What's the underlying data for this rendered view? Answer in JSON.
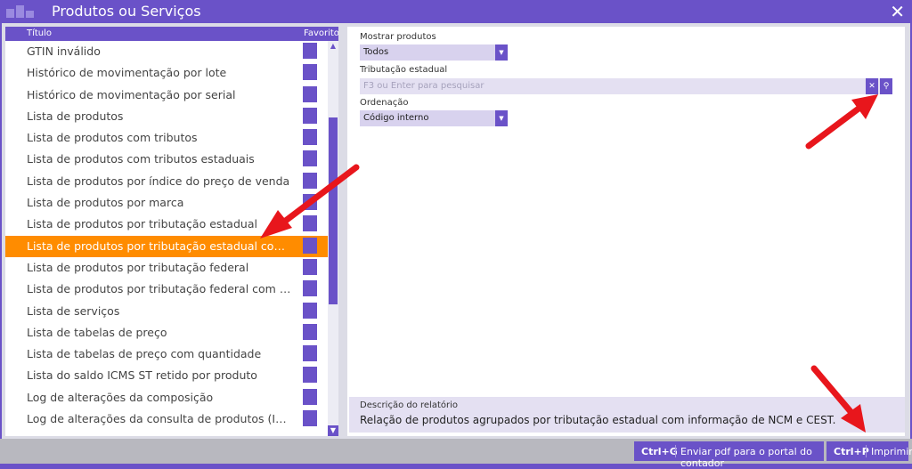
{
  "window": {
    "title": "Produtos ou Serviços",
    "app_icon": "boxes-icon",
    "close_icon": "close-icon"
  },
  "list": {
    "header_title": "Título",
    "header_favorite": "Favorito",
    "items": [
      {
        "label": "GTIN inválido"
      },
      {
        "label": "Histórico de movimentação por lote"
      },
      {
        "label": "Histórico de movimentação por serial"
      },
      {
        "label": "Lista de produtos"
      },
      {
        "label": "Lista de produtos com tributos"
      },
      {
        "label": "Lista de produtos com tributos estaduais"
      },
      {
        "label": "Lista de produtos por índice do preço de venda"
      },
      {
        "label": "Lista de produtos por marca"
      },
      {
        "label": "Lista de produtos por tributação estadual"
      },
      {
        "label": "Lista de produtos por tributação estadual com NCM..."
      },
      {
        "label": "Lista de produtos por tributação federal"
      },
      {
        "label": "Lista de produtos por tributação federal com NCM e..."
      },
      {
        "label": "Lista de serviços"
      },
      {
        "label": "Lista de tabelas de preço"
      },
      {
        "label": "Lista de tabelas de preço com quantidade"
      },
      {
        "label": "Lista do saldo ICMS ST retido por produto"
      },
      {
        "label": "Log de alterações da composição"
      },
      {
        "label": "Log de alterações da consulta de produtos (IMendes)"
      }
    ],
    "selected_index": 9
  },
  "filters": {
    "show_products_label": "Mostrar produtos",
    "show_products_value": "Todos",
    "state_tax_label": "Tributação estadual",
    "state_tax_placeholder": "F3 ou Enter para pesquisar",
    "order_label": "Ordenação",
    "order_value": "Código interno"
  },
  "description": {
    "title": "Descrição do relatório",
    "text": "Relação de produtos agrupados por tributação estadual com informação de NCM e CEST."
  },
  "bottom": {
    "send_key": "Ctrl+G",
    "send_label": "Enviar pdf para o portal do contador",
    "print_key": "Ctrl+P",
    "print_label": "Imprimir"
  },
  "colors": {
    "accent": "#6a52c8",
    "selected": "#ff8c00",
    "annotation": "#e8161c"
  }
}
